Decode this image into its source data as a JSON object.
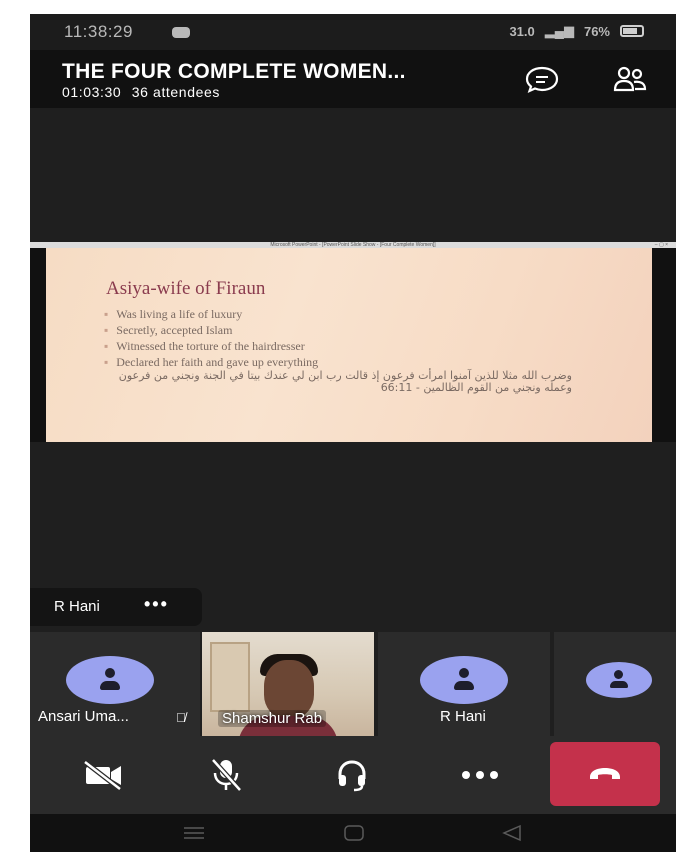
{
  "status_bar": {
    "time": "11:38:29",
    "speed": "31.0",
    "battery": "76%"
  },
  "meeting": {
    "title": "THE FOUR COMPLETE WOMEN...",
    "duration": "01:03:30",
    "attendees": "36 attendees"
  },
  "slide": {
    "window_title": "Microsoft PowerPoint - [PowerPoint Slide Show - [Four Complete Women]]",
    "heading": "Asiya-wife of Firaun",
    "bullets": [
      "Was living a life of luxury",
      "Secretly, accepted Islam",
      "Witnessed the torture of the hairdresser",
      "Declared her faith and gave up everything"
    ],
    "arabic": "وضرب الله مثلا للذين آمنوا امرأت فرعون إذ قالت رب ابن لي عندك بيتا في الجنة ونجني من فرعون وعمله ونجني من القوم الظالمين - 66:11"
  },
  "spotlight": {
    "name": "R Hani",
    "more": "•••"
  },
  "participants": [
    {
      "name": "Ansari Uma..."
    },
    {
      "name": "Shamshur Rab"
    },
    {
      "name": "R Hani"
    },
    {
      "name": ""
    }
  ],
  "colors": {
    "hangup": "#c4314b",
    "avatar": "#9aa2ef",
    "background": "#1f1f1f"
  },
  "icons": {
    "video_off": "video-off-icon",
    "mic_off": "mic-off-icon",
    "audio": "headset-icon",
    "more": "more-icon",
    "hangup": "phone-hangup-icon",
    "chat": "chat-icon",
    "people": "people-icon"
  }
}
